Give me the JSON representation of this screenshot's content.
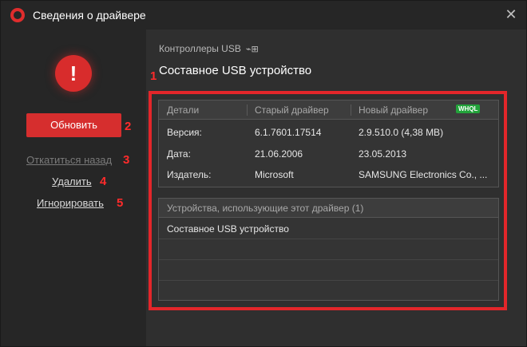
{
  "window": {
    "title": "Сведения о драйвере",
    "close_label": "✕"
  },
  "sidebar": {
    "update_label": "Обновить",
    "rollback_label": "Откатиться назад",
    "delete_label": "Удалить",
    "ignore_label": "Игнорировать"
  },
  "markers": [
    "1",
    "2",
    "3",
    "4",
    "5"
  ],
  "main": {
    "category": "Контроллеры USB",
    "device_name": "Составное USB устройство"
  },
  "details": {
    "headers": {
      "details": "Детали",
      "old": "Старый драйвер",
      "new": "Новый драйвер",
      "badge": "WHQL"
    },
    "rows": [
      {
        "label": "Версия:",
        "old": "6.1.7601.17514",
        "new": "2.9.510.0 (4,38 MB)"
      },
      {
        "label": "Дата:",
        "old": "21.06.2006",
        "new": "23.05.2013"
      },
      {
        "label": "Издатель:",
        "old": "Microsoft",
        "new": "SAMSUNG Electronics Co., ..."
      }
    ]
  },
  "devices": {
    "header": "Устройства, использующие этот драйвер (1)",
    "items": [
      "Составное USB устройство"
    ]
  },
  "colors": {
    "accent": "#d62e2e",
    "highlight": "#e3262a",
    "badge": "#22a33a"
  }
}
